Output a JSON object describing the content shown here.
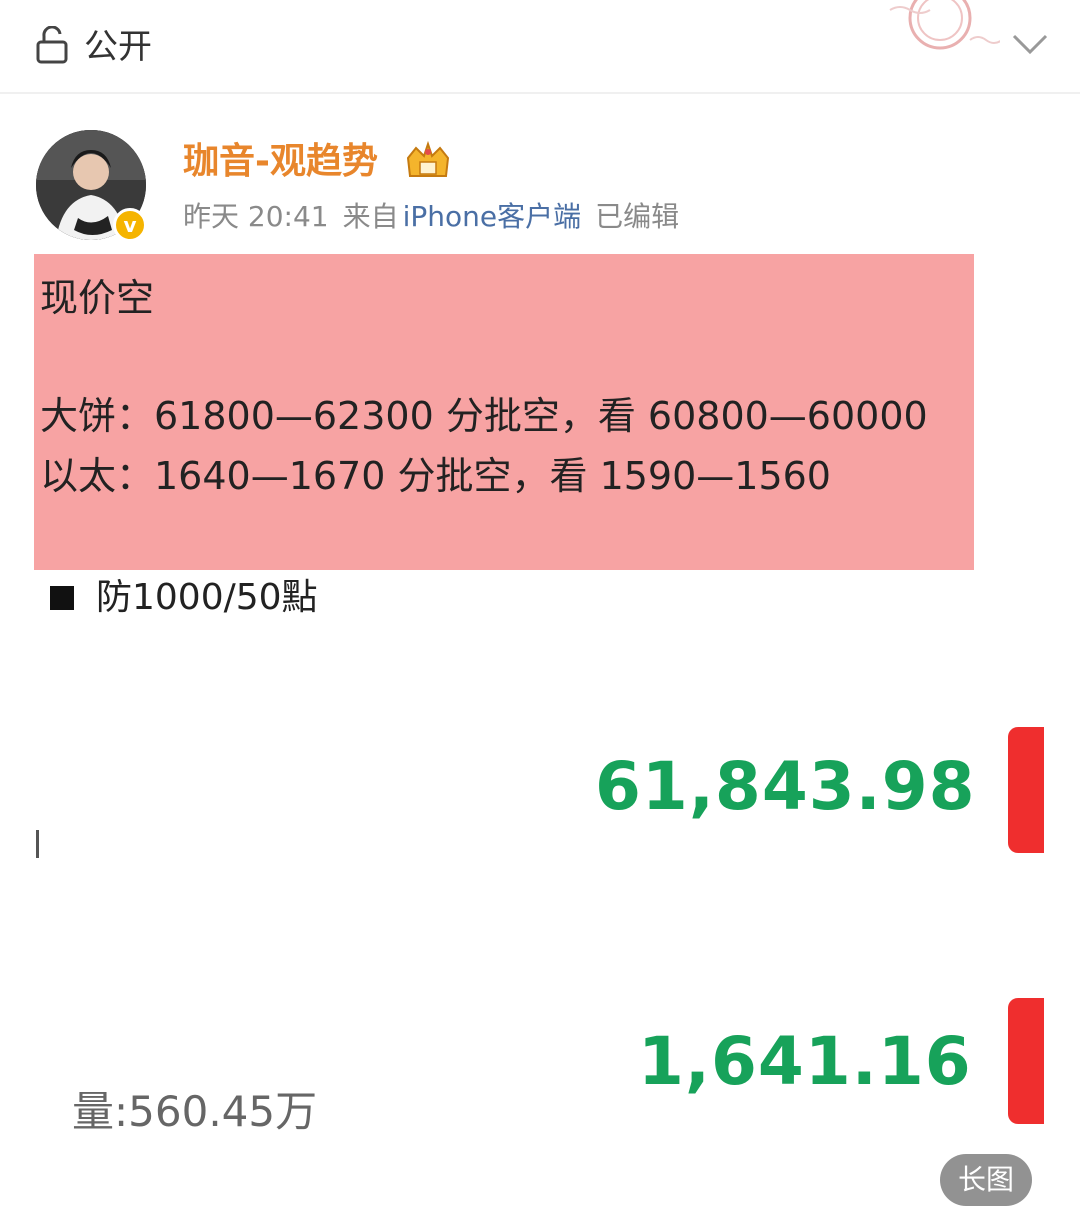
{
  "topbar": {
    "visibility_label": "公开",
    "icons": [
      "lock-icon",
      "stamp-icon",
      "chevron-down-icon"
    ]
  },
  "post": {
    "username": "珈音-观趋势",
    "time": "昨天 20:41",
    "source_prefix": "来自",
    "source": "iPhone客户端",
    "edited": "已编辑",
    "icons": [
      "avatar",
      "verified-badge",
      "crown-icon"
    ],
    "verify_letter": "v",
    "highlight": {
      "line1": "现价空",
      "line2": "大饼：61800—62300 分批空，看 60800—60000",
      "line3": "以太：1640—1670 分批空，看 1590—1560"
    },
    "defense": "防1000/50點"
  },
  "prices": {
    "btc_price": "61,843.98",
    "eth_price": "1,641.16",
    "volume": "量:560.45万"
  },
  "long_image_label": "长图",
  "colors": {
    "username": "#e8862c",
    "highlight_bg": "#f7a3a3",
    "price_green": "#17a25a",
    "bar_red": "#ef2e2e",
    "source_blue": "#4a6fa5"
  }
}
